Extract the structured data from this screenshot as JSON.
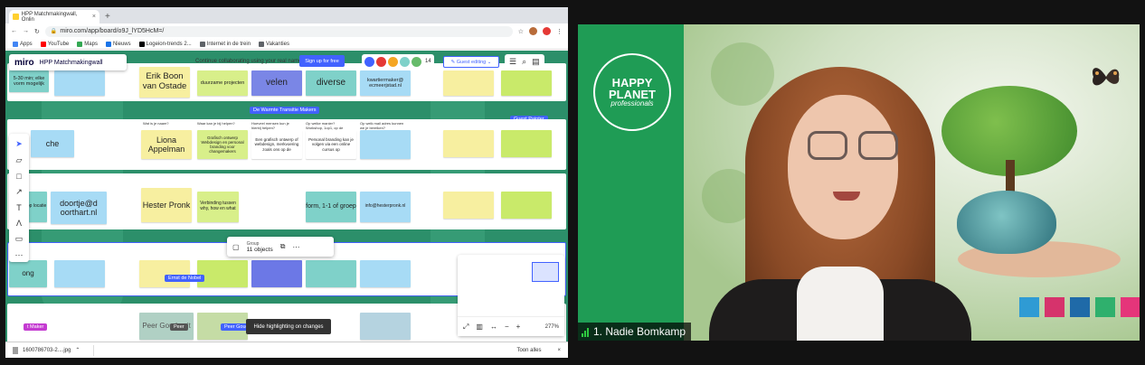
{
  "browser": {
    "tab_title": "HPP Matchmakingwall, Onlin",
    "tab_close": "×",
    "new_tab": "+",
    "url": "miro.com/app/board/o9J_lYD5HcM=/",
    "bookmarks": [
      {
        "label": "Apps",
        "color": "#4285f4"
      },
      {
        "label": "YouTube",
        "color": "#ff0000"
      },
      {
        "label": "Maps",
        "color": "#34a853"
      },
      {
        "label": "Nieuws",
        "color": "#1a73e8"
      },
      {
        "label": "Logeion-trends 2...",
        "color": "#000000"
      },
      {
        "label": "Internet in de trein",
        "color": "#5f6368"
      },
      {
        "label": "Vakanties",
        "color": "#5f6368"
      }
    ],
    "download_file": "1600786703-2....jpg",
    "download_show_all": "Toon alles",
    "download_close": "×"
  },
  "miro": {
    "logo": "miro",
    "board_name": "HPP Matchmakingwall",
    "collab_text": "Continue collaborating using your real name.",
    "signup": "Sign up for free",
    "participant_count": "14",
    "editing_button": "Guest editing",
    "selection_label": "Group",
    "selection_count": "11 objects",
    "hide_highlight": "Hide highlighting on changes",
    "zoom": "277%",
    "tags": [
      {
        "text": "De Warmte Transitie Makers",
        "color": "#4262ff"
      },
      {
        "text": "Guest Painter",
        "color": "#4262ff"
      },
      {
        "text": "Ernst de Nobel",
        "color": "#4262ff"
      },
      {
        "text": "Peer",
        "color": "#555555"
      },
      {
        "text": "Peer Gouds",
        "color": "#4262ff"
      },
      {
        "text": "t Maker",
        "color": "#c43bd1"
      }
    ],
    "row_headers": [
      "Wat is je naam?",
      "Waar kan je bij helpen?",
      "Hoeveel mensen kun je hierbij helpen?",
      "Op welke manier? Workshop, 1op1, op de zaak, etc.",
      "Op welk mail adres kunnen we je bereiken?"
    ],
    "stickies": {
      "row0": [
        "Erik Boon van Ostade",
        "duurzame projecten",
        "velen",
        "diverse",
        "kwartiermaker@ ecmeerjstad.nl",
        "5-30 min; elke vorm mogelijk"
      ],
      "row1": [
        "Liona Appelman",
        "Grafisch ontwerp Webdesign en personal branding voor changemakers",
        "Een grafisch ontwerp of webdesign, merkvoering zoals ons op de",
        "Personal branding kan je volgen via een online cursus op",
        "che"
      ],
      "row2": [
        "Hester Pronk",
        "Verbinding tussen why, how en what",
        "form, 1-1 of groep",
        "info@hesterpronk.nl",
        "doortje@d oorthart.nl",
        "orkshop op locatie"
      ],
      "row4": [
        "Peer Goudsmit",
        "ong"
      ]
    }
  },
  "video": {
    "logo_line1": "HAPPY",
    "logo_line2": "PLANET",
    "logo_line3": "professionals",
    "participant_name": "1. Nadie Bomkamp",
    "brand_squares": [
      "#2f9bd4",
      "#d6336c",
      "#1f6aa8",
      "#2fb06d",
      "#e5357a"
    ]
  }
}
